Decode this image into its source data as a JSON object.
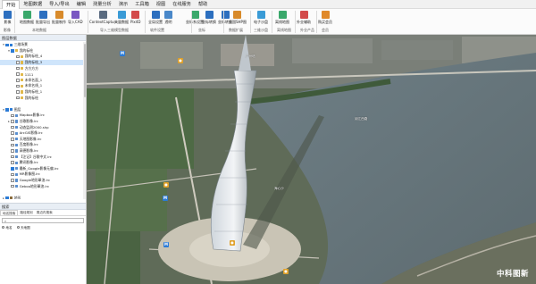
{
  "menu": [
    "开始",
    "地图数据",
    "导入/导出",
    "编辑",
    "测量分析",
    "演示",
    "工具箱",
    "视图",
    "在线服务",
    "帮助"
  ],
  "ribbon": {
    "tools": [
      {
        "label": "影像",
        "color": "#2c6fbf"
      },
      {
        "label": "地图数据",
        "color": "#3aa86b"
      },
      {
        "label": "批量导出",
        "color": "#2c6fbf"
      },
      {
        "label": "批量制作",
        "color": "#d88a2a"
      },
      {
        "label": "导入CAD",
        "color": "#7a58c2"
      },
      {
        "label": "ContextCapture",
        "color": "#5a6b80"
      },
      {
        "label": "大量数据",
        "color": "#3a9bd6"
      },
      {
        "label": "Pix4D",
        "color": "#d34a4a"
      },
      {
        "label": "全局设置",
        "color": "#2c6fbf"
      },
      {
        "label": "透明",
        "color": "#4a88c9"
      },
      {
        "label": "坐标系设置",
        "color": "#3aa86b"
      },
      {
        "label": "坐标转换",
        "color": "#2c6fbf"
      },
      {
        "label": "坐标转换",
        "color": "#2c6fbf"
      },
      {
        "label": "全国SHP图",
        "color": "#d88a2a"
      },
      {
        "label": "电子沙盘",
        "color": "#3a9bd6"
      },
      {
        "label": "离线地图",
        "color": "#3aa86b"
      },
      {
        "label": "外业辅助",
        "color": "#d34a4a"
      },
      {
        "label": "购买会员",
        "color": "#e0892a"
      }
    ],
    "groups": [
      "影像",
      "本地数据",
      "导入三维模型数据",
      "软件设置",
      "坐标",
      "数据扩展",
      "三维沙盘",
      "离线地图",
      "外业产品",
      "会员"
    ]
  },
  "left": {
    "title": "图层数据",
    "tree": [
      {
        "label": "三维场景",
        "level": 0,
        "twist": "▾",
        "checked": true,
        "color": "#2b7bd6",
        "selected": false
      },
      {
        "label": "我的标绘",
        "level": 1,
        "twist": "▾",
        "checked": true,
        "color": "#e0b84a",
        "selected": false
      },
      {
        "label": "我的标绘_4",
        "level": 2,
        "twist": "",
        "checked": false,
        "color": "#e0b84a",
        "selected": false
      },
      {
        "label": "我的标绘_3",
        "level": 2,
        "twist": "",
        "checked": false,
        "color": "#e0b84a",
        "selected": true
      },
      {
        "label": "方方方方",
        "level": 2,
        "twist": "",
        "checked": false,
        "color": "#e0b84a",
        "selected": false
      },
      {
        "label": "1111",
        "level": 2,
        "twist": "",
        "checked": false,
        "color": "#e0b84a",
        "selected": false
      },
      {
        "label": "未命名面_1",
        "level": 2,
        "twist": "",
        "checked": false,
        "color": "#e0b84a",
        "selected": false
      },
      {
        "label": "未命名线_1",
        "level": 2,
        "twist": "",
        "checked": false,
        "color": "#e0b84a",
        "selected": false
      },
      {
        "label": "我的标绘_1",
        "level": 2,
        "twist": "",
        "checked": false,
        "color": "#e0b84a",
        "selected": false
      },
      {
        "label": "我的标绘",
        "level": 2,
        "twist": "",
        "checked": false,
        "color": "#e0b84a",
        "selected": false
      },
      {
        "label": "",
        "level": 0,
        "twist": "",
        "checked": false,
        "color": "",
        "selected": false
      },
      {
        "label": "图层",
        "level": 0,
        "twist": "▾",
        "checked": true,
        "color": "#2b7bd6",
        "selected": false
      },
      {
        "label": "Mapbox影像.lrc",
        "level": 1,
        "twist": "",
        "checked": false,
        "color": "#5a8fcf",
        "selected": false
      },
      {
        "label": "谷歌影像.lrc",
        "level": 1,
        "twist": "▸",
        "checked": false,
        "color": "#5a8fcf",
        "selected": false
      },
      {
        "label": "动态监测2000.shp",
        "level": 1,
        "twist": "",
        "checked": false,
        "color": "#5a8fcf",
        "selected": false
      },
      {
        "label": "ArcGIS影像.lrc",
        "level": 1,
        "twist": "",
        "checked": false,
        "color": "#5a8fcf",
        "selected": false
      },
      {
        "label": "天地图影像.lrc",
        "level": 1,
        "twist": "",
        "checked": false,
        "color": "#5a8fcf",
        "selected": false
      },
      {
        "label": "百度影像.lrc",
        "level": 1,
        "twist": "",
        "checked": false,
        "color": "#5a8fcf",
        "selected": false
      },
      {
        "label": "高德影像.lrc",
        "level": 1,
        "twist": "",
        "checked": false,
        "color": "#5a8fcf",
        "selected": false
      },
      {
        "label": "【注记】谷歌中文.lrc",
        "level": 1,
        "twist": "",
        "checked": false,
        "color": "#5a8fcf",
        "selected": false
      },
      {
        "label": "腾讯影像.lrc",
        "level": 1,
        "twist": "",
        "checked": false,
        "color": "#5a8fcf",
        "selected": false
      },
      {
        "label": "最新_Google影像无偏.lrc",
        "level": 1,
        "twist": "",
        "checked": true,
        "color": "#5a8fcf",
        "selected": false
      },
      {
        "label": "MR影像图.lrc",
        "level": 1,
        "twist": "",
        "checked": false,
        "color": "#5a8fcf",
        "selected": false
      },
      {
        "label": "Google地形晕渲.lrc",
        "level": 1,
        "twist": "",
        "checked": false,
        "color": "#5a8fcf",
        "selected": false
      },
      {
        "label": "Geboo地形晕渲.lrc",
        "level": 1,
        "twist": "",
        "checked": false,
        "color": "#5a8fcf",
        "selected": false
      },
      {
        "label": "",
        "level": 0,
        "twist": "",
        "checked": false,
        "color": "",
        "selected": false
      },
      {
        "label": "地形",
        "level": 0,
        "twist": "▸",
        "checked": true,
        "color": "#8a6a3a",
        "selected": false
      }
    ]
  },
  "search": {
    "title": "搜索",
    "tabs": [
      "地名搜索",
      "路径规划",
      "周边内搜索"
    ],
    "placeholder": "",
    "radio_options": [
      "地名",
      "天地图"
    ]
  },
  "map": {
    "watermark": "中科图新",
    "labels": [
      "广州塔",
      "阅江西路",
      "海心沙"
    ]
  }
}
